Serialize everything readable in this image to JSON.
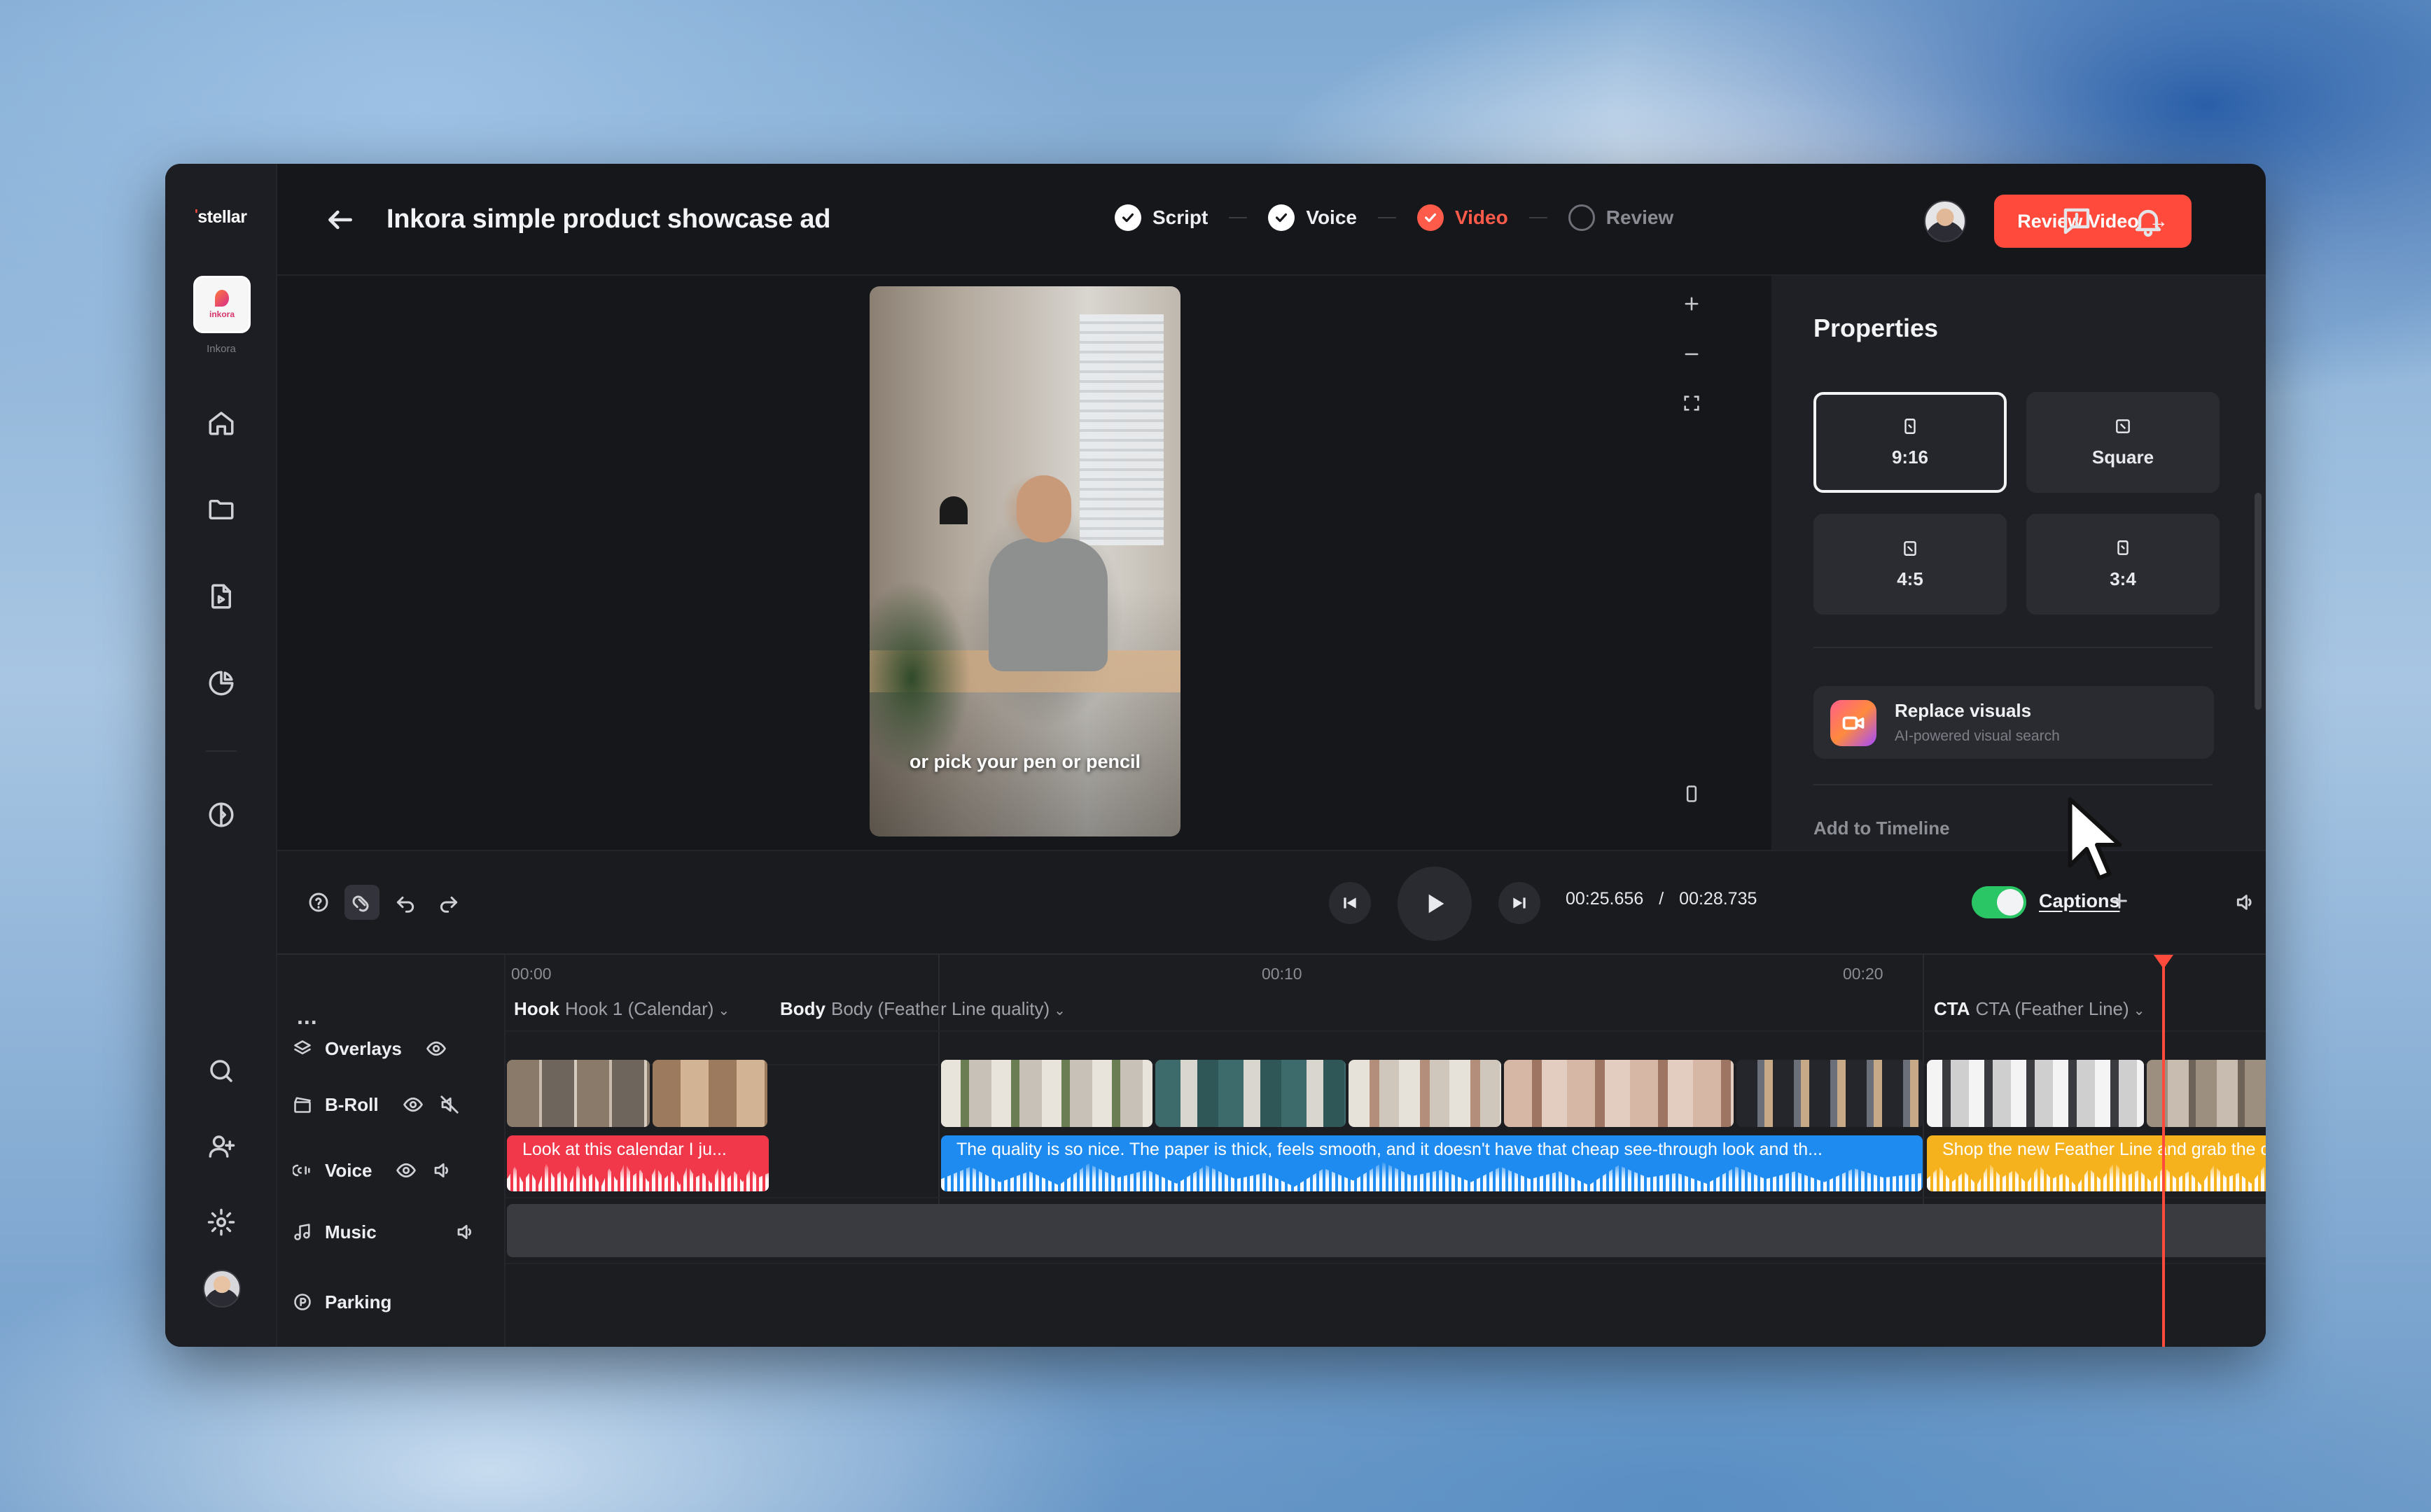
{
  "app": {
    "logo": "stellar",
    "workspace_name": "Inkora",
    "workspace_badge": "inkora"
  },
  "header": {
    "title": "Inkora simple product showcase ad",
    "steps": [
      {
        "label": "Script",
        "state": "done"
      },
      {
        "label": "Voice",
        "state": "done"
      },
      {
        "label": "Video",
        "state": "active"
      },
      {
        "label": "Review",
        "state": "todo"
      }
    ],
    "review_button": "Review Video",
    "review_arrow": "→"
  },
  "preview": {
    "caption": "or pick your pen or pencil"
  },
  "properties": {
    "title": "Properties",
    "ratios": [
      {
        "label": "9:16",
        "selected": true
      },
      {
        "label": "Square",
        "selected": false
      },
      {
        "label": "4:5",
        "selected": false
      },
      {
        "label": "3:4",
        "selected": false
      }
    ],
    "replace": {
      "title": "Replace visuals",
      "subtitle": "AI-powered visual search"
    },
    "add_to_timeline": "Add to Timeline"
  },
  "transport": {
    "current_time": "00:25.656",
    "separator": "/",
    "total_time": "00:28.735",
    "captions_label": "Captions",
    "captions_enabled": true
  },
  "timeline": {
    "more": "...",
    "ruler": [
      "00:00",
      "00:10",
      "00:20"
    ],
    "sections": [
      {
        "name": "Hook",
        "detail": "Hook 1 (Calendar)"
      },
      {
        "name": "Body",
        "detail": "Body (Feather Line quality)"
      },
      {
        "name": "CTA",
        "detail": "CTA (Feather Line)"
      }
    ],
    "tracks": {
      "overlays": "Overlays",
      "broll": "B-Roll",
      "voice": "Voice",
      "music": "Music",
      "parking": "Parking"
    },
    "voice_clips": [
      {
        "text": "Look at this calendar I ju...",
        "color": "#f0384a"
      },
      {
        "text": "The quality is so nice. The paper is thick, feels smooth, and it doesn't have that cheap see-through look and th...",
        "color": "#1e8bf0"
      },
      {
        "text": "Shop the new Feather Line and grab the c...",
        "color": "#f6b21d"
      }
    ]
  },
  "colors": {
    "accent": "#ff4a3c",
    "toggle_on": "#2ac665",
    "background": "#16171b"
  }
}
